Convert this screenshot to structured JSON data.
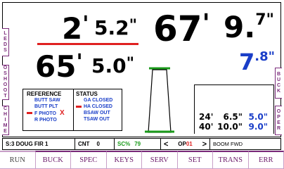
{
  "left_tabs": [
    "LEDS",
    "OSHOOT",
    "CHIME"
  ],
  "right_tabs": [
    "BUCK",
    "OPER"
  ],
  "measure_top": {
    "feet": "2",
    "feet_mark": "'",
    "inches": "5.2",
    "inch_mark": "\""
  },
  "measure_bottom": {
    "feet": "65",
    "feet_mark": "'",
    "inches": "5.0",
    "inch_mark": "\""
  },
  "length": {
    "value": "67",
    "mark": "'"
  },
  "diameter": {
    "value": "9.",
    "superscript": "7\""
  },
  "diameter_small": {
    "value": "7",
    "superscript": ".8\""
  },
  "reference": {
    "title": "REFERENCE",
    "items": [
      "BUTT SAW",
      "BUTT PLT",
      "F PHOTO",
      "R PHOTO"
    ],
    "mark": "X"
  },
  "status": {
    "title": "STATUS",
    "items": [
      "GA CLOSED",
      "HA CLOSED",
      "BSAW OUT",
      "TSAW OUT"
    ]
  },
  "cut_rows": [
    {
      "feet": "24'",
      "inches": "6.5\"",
      "dia": "5.0\""
    },
    {
      "feet": "40'",
      "inches": "10.0\"",
      "dia": "9.0\""
    }
  ],
  "status_bar": {
    "species": "S:3 DOUG FIR 1",
    "cnt_label": "CNT",
    "cnt_value": "0",
    "sc_label": "SC%",
    "sc_value": "79",
    "op_label": "OP",
    "op_value": "01",
    "prev_arrow": "<",
    "next_arrow": ">",
    "boom": "BOOM FWD"
  },
  "menu": [
    "RUN",
    "BUCK",
    "SPEC",
    "KEYS",
    "SERV",
    "SET",
    "TRANS",
    "ERR"
  ],
  "colors": {
    "red": "#e02020",
    "green": "#1a9a1a",
    "blue": "#1a3ec8",
    "purple": "#7a2a7a"
  }
}
